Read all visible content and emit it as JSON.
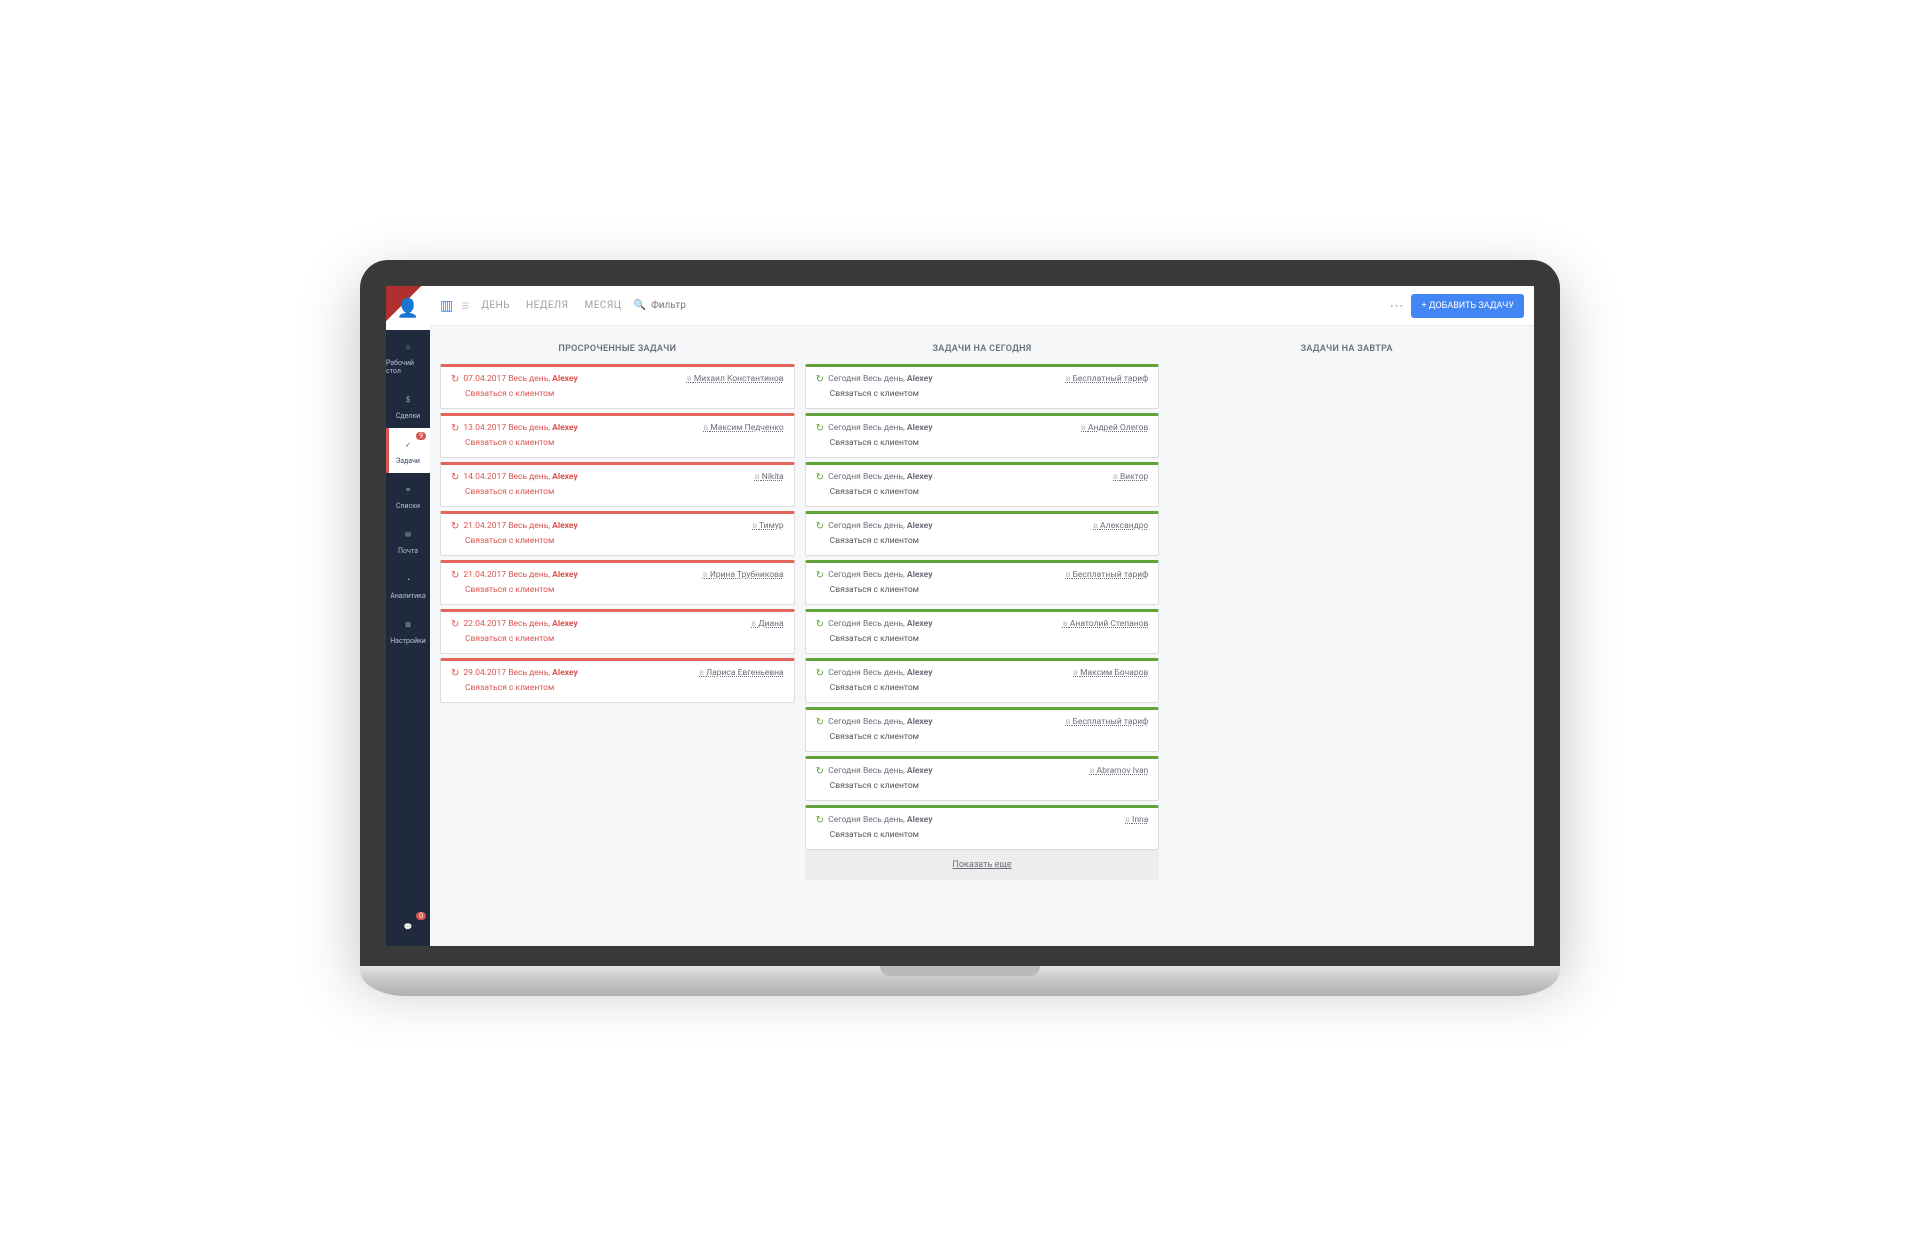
{
  "sidebar": {
    "items": [
      {
        "label": "Рабочий стол",
        "icon": "⌂"
      },
      {
        "label": "Сделки",
        "icon": "$"
      },
      {
        "label": "Задачи",
        "icon": "✓",
        "badge": "9"
      },
      {
        "label": "Списки",
        "icon": "≡"
      },
      {
        "label": "Почта",
        "icon": "✉"
      },
      {
        "label": "Аналитика",
        "icon": "◔"
      },
      {
        "label": "Настройки",
        "icon": "⚙"
      }
    ],
    "chat_badge": "0"
  },
  "topbar": {
    "views": [
      "ДЕНЬ",
      "НЕДЕЛЯ",
      "МЕСЯЦ"
    ],
    "filter_placeholder": "Фильтр",
    "add_label": "+ ДОБАВИТЬ ЗАДАЧУ"
  },
  "columns": [
    {
      "title": "ПРОСРОЧЕННЫЕ ЗАДАЧИ",
      "class": "overdue",
      "tasks": [
        {
          "date": "07.04.2017",
          "time": "Весь день",
          "user": "Alexey",
          "title": "Связаться с клиентом",
          "contact": "Михаил Константинов"
        },
        {
          "date": "13.04.2017",
          "time": "Весь день",
          "user": "Alexey",
          "title": "Связаться с клиентом",
          "contact": "Максим Педченко"
        },
        {
          "date": "14.04.2017",
          "time": "Весь день",
          "user": "Alexey",
          "title": "Связаться с клиентом",
          "contact": "Nikita"
        },
        {
          "date": "21.04.2017",
          "time": "Весь день",
          "user": "Alexey",
          "title": "Связаться с клиентом",
          "contact": "Тимур"
        },
        {
          "date": "21.04.2017",
          "time": "Весь день",
          "user": "Alexey",
          "title": "Связаться с клиентом",
          "contact": "Ирина Трубникова"
        },
        {
          "date": "22.04.2017",
          "time": "Весь день",
          "user": "Alexey",
          "title": "Связаться с клиентом",
          "contact": "Диана"
        },
        {
          "date": "29.04.2017",
          "time": "Весь день",
          "user": "Alexey",
          "title": "Связаться с клиентом",
          "contact": "Лариса Евгеньевна"
        }
      ]
    },
    {
      "title": "ЗАДАЧИ НА СЕГОДНЯ",
      "class": "today",
      "show_more": "Показать еще",
      "tasks": [
        {
          "date": "Сегодня",
          "time": "Весь день",
          "user": "Alexey",
          "title": "Связаться с клиентом",
          "contact": "Бесплатный тариф"
        },
        {
          "date": "Сегодня",
          "time": "Весь день",
          "user": "Alexey",
          "title": "Связаться с клиентом",
          "contact": "Андрей Олегов"
        },
        {
          "date": "Сегодня",
          "time": "Весь день",
          "user": "Alexey",
          "title": "Связаться с клиентом",
          "contact": "Виктор"
        },
        {
          "date": "Сегодня",
          "time": "Весь день",
          "user": "Alexey",
          "title": "Связаться с клиентом",
          "contact": "Александро"
        },
        {
          "date": "Сегодня",
          "time": "Весь день",
          "user": "Alexey",
          "title": "Связаться с клиентом",
          "contact": "Бесплатный тариф"
        },
        {
          "date": "Сегодня",
          "time": "Весь день",
          "user": "Alexey",
          "title": "Связаться с клиентом",
          "contact": "Анатолий Степанов"
        },
        {
          "date": "Сегодня",
          "time": "Весь день",
          "user": "Alexey",
          "title": "Связаться с клиентом",
          "contact": "Максим Бочаров"
        },
        {
          "date": "Сегодня",
          "time": "Весь день",
          "user": "Alexey",
          "title": "Связаться с клиентом",
          "contact": "Бесплатный тариф"
        },
        {
          "date": "Сегодня",
          "time": "Весь день",
          "user": "Alexey",
          "title": "Связаться с клиентом",
          "contact": "Abramov Ivan"
        },
        {
          "date": "Сегодня",
          "time": "Весь день",
          "user": "Alexey",
          "title": "Связаться с клиентом",
          "contact": "Inna"
        }
      ]
    },
    {
      "title": "ЗАДАЧИ НА ЗАВТРА",
      "class": "tomorrow",
      "tasks": []
    }
  ]
}
